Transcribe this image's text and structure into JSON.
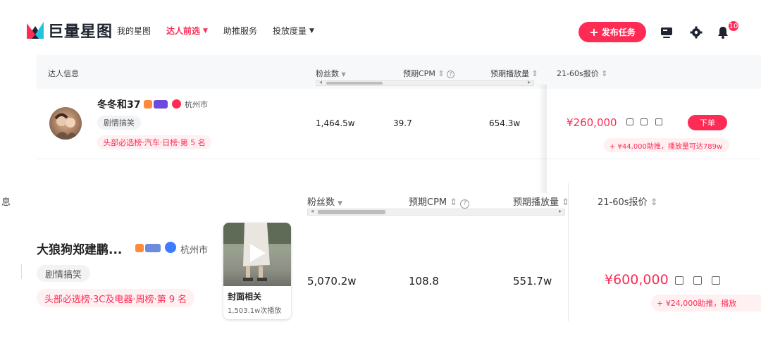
{
  "nav": {
    "logo_text": "巨量星图",
    "items": [
      {
        "label": "我的星图",
        "active": false,
        "caret": false
      },
      {
        "label": "达人前选",
        "active": true,
        "caret": true
      },
      {
        "label": "助推服务",
        "active": false,
        "caret": false
      },
      {
        "label": "投放度量",
        "active": false,
        "caret": true
      }
    ],
    "caret_glyph": "▼",
    "publish_plus": "+",
    "publish_label": "发布任务",
    "notification_count": "10",
    "icons": [
      "screen-icon",
      "gear-icon",
      "bell-icon"
    ]
  },
  "table1": {
    "headers": {
      "creator": "达人信息",
      "fans": "粉丝数",
      "sort_desc": "▼",
      "cpm": "预期CPM",
      "sort_both": "⇕",
      "help": "?",
      "plays": "预期播放量",
      "price": "21-60s报价"
    },
    "row": {
      "name": "冬冬和37",
      "city": "杭州市",
      "category": "剧情搞笑",
      "rank": "头部必选榜·汽车·日榜·第 5 名",
      "fans": "1,464.5w",
      "cpm": "39.7",
      "plays": "654.3w",
      "price": "¥260,000",
      "order_label": "下单",
      "boost_note": "+ ¥44,000助推，播放量可达789w"
    }
  },
  "table2": {
    "headers": {
      "creator_partial": "息",
      "fans": "粉丝数",
      "cpm": "预期CPM",
      "plays": "预期播放量",
      "price": "21-60s报价"
    },
    "row": {
      "name": "大狼狗郑建鹏...",
      "city": "杭州市",
      "category": "剧情搞笑",
      "rank": "头部必选榜·3C及电器·周榜·第 9 名",
      "video_title": "封面相关",
      "video_plays": "1,503.1w次播放",
      "fans": "5,070.2w",
      "cpm": "108.8",
      "plays": "551.7w",
      "price": "¥600,000",
      "boost_note": "+ ¥24,000助推，播放"
    }
  },
  "colors": {
    "accent": "#fe2c55",
    "header_bg": "#f7f8fa",
    "chip_bg": "#f2f3f5",
    "rank_bg": "#fff0f2"
  }
}
